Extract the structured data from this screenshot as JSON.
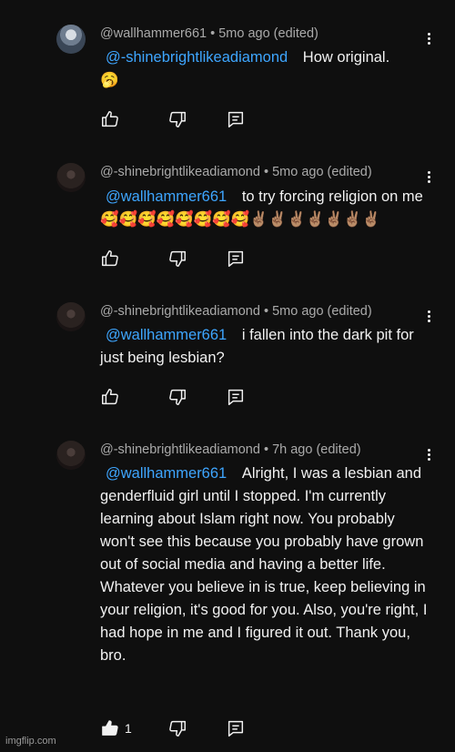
{
  "comments": [
    {
      "author": "@wallhammer661",
      "age": "5mo ago (edited)",
      "mention": "@-shinebrightlikeadiamond",
      "text": "How original.",
      "emoji": "🥱",
      "likes": ""
    },
    {
      "author": "@-shinebrightlikeadiamond",
      "age": "5mo ago (edited)",
      "mention": "@wallhammer661",
      "text": "to try forcing religion on me 🥰🥰🥰🥰🥰🥰🥰🥰✌🏽✌🏽✌🏽✌🏽✌🏽✌🏽✌🏽",
      "likes": ""
    },
    {
      "author": "@-shinebrightlikeadiamond",
      "age": "5mo ago (edited)",
      "mention": "@wallhammer661",
      "text": "i fallen into the dark pit for just being lesbian?",
      "likes": ""
    },
    {
      "author": "@-shinebrightlikeadiamond",
      "age": "7h ago (edited)",
      "mention": "@wallhammer661",
      "text": "Alright, I was a lesbian and genderfluid girl until I stopped. I'm currently learning about Islam right now. You probably won't see this because you probably have grown out of social media and having a better life. Whatever you believe in is true, keep believing in your religion, it's good for you. Also, you're right, I had hope in me and I figured it out. Thank you, bro.",
      "likes": "1"
    }
  ],
  "separator": " • ",
  "watermark": "imgflip.com"
}
